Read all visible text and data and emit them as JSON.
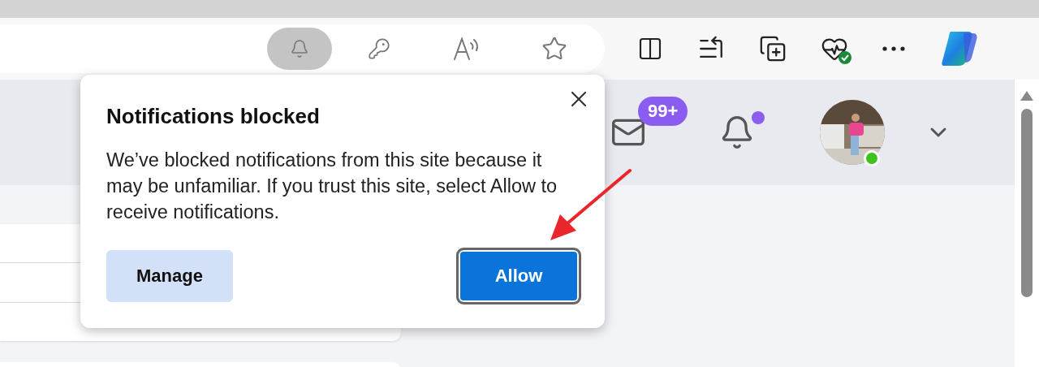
{
  "toolbar": {
    "address_bar_buttons": [
      {
        "kind": "notification",
        "selected": true
      },
      {
        "kind": "password",
        "selected": false
      },
      {
        "kind": "read-aloud",
        "selected": false
      },
      {
        "kind": "favorite",
        "selected": false
      }
    ]
  },
  "header": {
    "mail_badge": "99+",
    "bell_unread": true,
    "avatar": {
      "kind": "picture",
      "online": true
    }
  },
  "popup": {
    "title": "Notifications blocked",
    "message": "We’ve blocked notifications from this site because it may be unfamiliar. If you trust this site, select Allow to receive notifications.",
    "buttons": [
      {
        "label": "Manage",
        "kind": "secondary",
        "focused": false
      },
      {
        "label": "Allow",
        "kind": "primary",
        "focused": true
      }
    ]
  }
}
